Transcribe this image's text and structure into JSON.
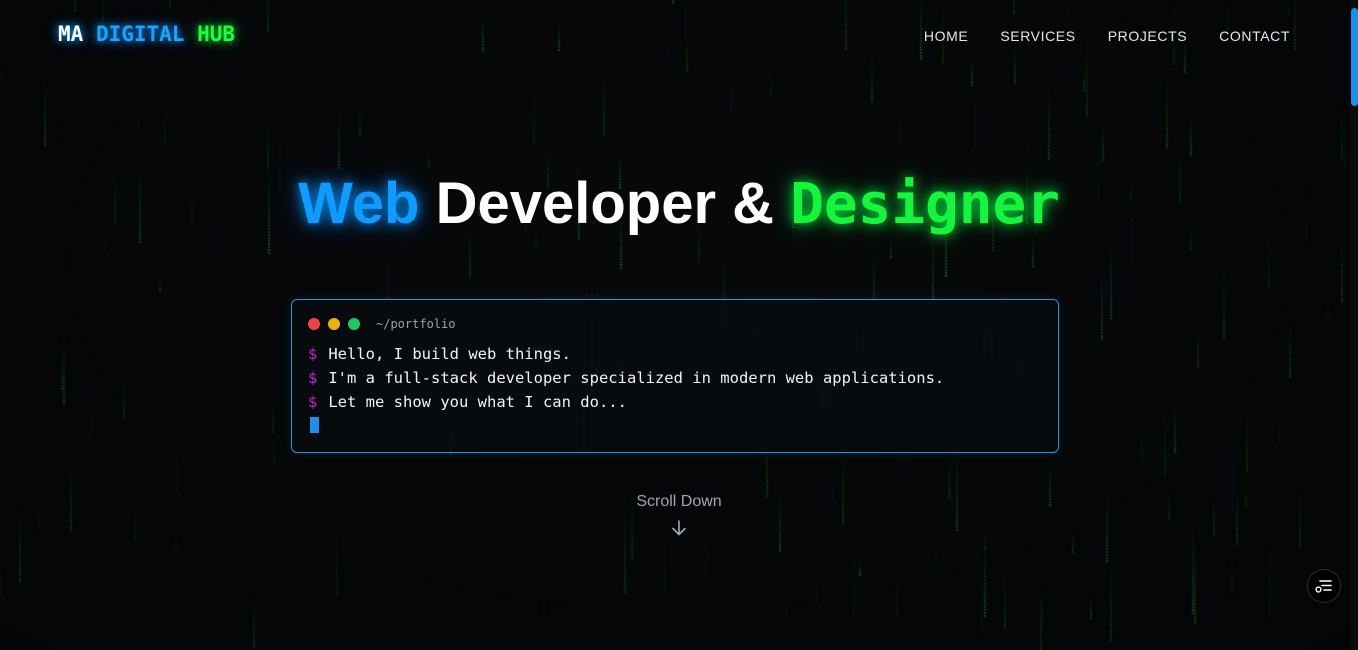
{
  "header": {
    "logo": {
      "part1": "MA",
      "part2": "DIGITAL",
      "part3": "HUB"
    },
    "nav": [
      {
        "label": "HOME"
      },
      {
        "label": "SERVICES"
      },
      {
        "label": "PROJECTS"
      },
      {
        "label": "CONTACT"
      }
    ]
  },
  "hero": {
    "title": {
      "word1": "Web",
      "word2": "Developer &",
      "word3": "Designer"
    }
  },
  "terminal": {
    "path": "~/portfolio",
    "prompt": "$",
    "lines": [
      "Hello, I build web things.",
      "I'm a full-stack developer specialized in modern web applications.",
      "Let me show you what I can do..."
    ]
  },
  "scroll": {
    "label": "Scroll Down",
    "icon": "arrow-down-icon"
  },
  "floating_button": {
    "icon": "settings-toggle-icon"
  },
  "colors": {
    "background": "#07090b",
    "accent_blue": "#0f9bff",
    "accent_green": "#15f53c",
    "prompt": "#c026d3",
    "terminal_border": "#2f8fe0"
  }
}
